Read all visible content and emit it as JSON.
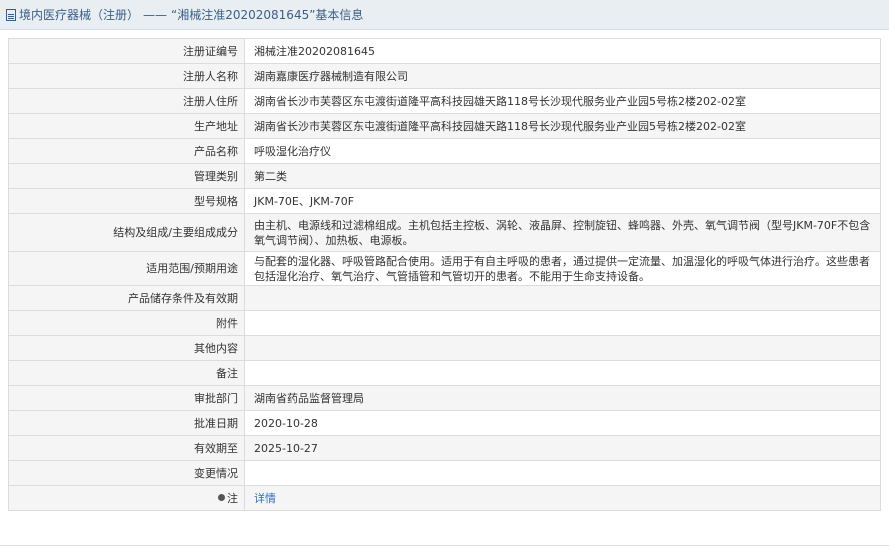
{
  "header": {
    "prefix": "境内医疗器械（注册）",
    "separator": "——",
    "title": "“湘械注准20202081645”基本信息"
  },
  "rows": [
    {
      "label": "注册证编号",
      "value": "湘械注准20202081645"
    },
    {
      "label": "注册人名称",
      "value": "湖南嘉康医疗器械制造有限公司"
    },
    {
      "label": "注册人住所",
      "value": "湖南省长沙市芙蓉区东屯渡街道隆平高科技园雄天路118号长沙现代服务业产业园5号栋2楼202-02室"
    },
    {
      "label": "生产地址",
      "value": "湖南省长沙市芙蓉区东屯渡街道隆平高科技园雄天路118号长沙现代服务业产业园5号栋2楼202-02室"
    },
    {
      "label": "产品名称",
      "value": "呼吸湿化治疗仪"
    },
    {
      "label": "管理类别",
      "value": "第二类"
    },
    {
      "label": "型号规格",
      "value": "JKM-70E、JKM-70F"
    },
    {
      "label": "结构及组成/主要组成成分",
      "value": "由主机、电源线和过滤棉组成。主机包括主控板、涡轮、液晶屏、控制旋钮、蜂鸣器、外壳、氧气调节阀（型号JKM-70F不包含氧气调节阀）、加热板、电源板。"
    },
    {
      "label": "适用范围/预期用途",
      "value": "与配套的湿化器、呼吸管路配合使用。适用于有自主呼吸的患者，通过提供一定流量、加温湿化的呼吸气体进行治疗。这些患者包括湿化治疗、氧气治疗、气管插管和气管切开的患者。不能用于生命支持设备。"
    },
    {
      "label": "产品储存条件及有效期",
      "value": ""
    },
    {
      "label": "附件",
      "value": ""
    },
    {
      "label": "其他内容",
      "value": ""
    },
    {
      "label": "备注",
      "value": ""
    },
    {
      "label": "审批部门",
      "value": "湖南省药品监督管理局"
    },
    {
      "label": "批准日期",
      "value": "2020-10-28"
    },
    {
      "label": "有效期至",
      "value": "2025-10-27"
    },
    {
      "label": "变更情况",
      "value": ""
    }
  ],
  "note": {
    "label": "注",
    "icon": "note-icon",
    "link_text": "详情"
  },
  "colors": {
    "header_bg": "#e9eef3",
    "header_text": "#3a5f86",
    "label_bg": "#f5f5f5",
    "border": "#dcdcdc",
    "link": "#2f6fb5"
  }
}
